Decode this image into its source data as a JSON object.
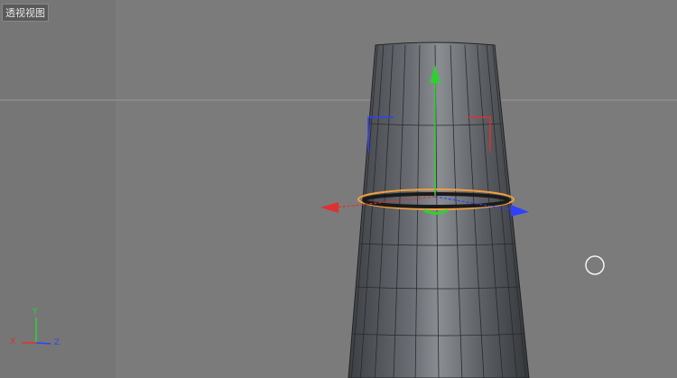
{
  "viewport": {
    "title": "透视视图"
  },
  "axis_indicator": {
    "x": "X",
    "y": "Y",
    "z": "Z"
  },
  "colors": {
    "x_axis": "#e03030",
    "y_axis": "#30d030",
    "z_axis": "#3040ff",
    "selection": "#f0a040",
    "background": "#7b7b7b"
  }
}
